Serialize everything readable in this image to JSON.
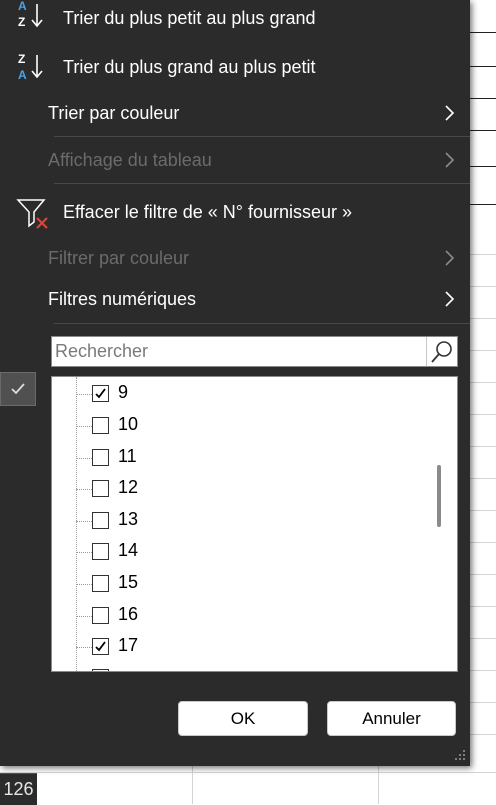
{
  "menu": {
    "sort_asc": "Trier du plus petit au plus grand",
    "sort_desc": "Trier du plus grand au plus petit",
    "sort_by_color": "Trier par couleur",
    "table_view": "Affichage du tableau",
    "clear_filter": "Effacer le filtre de « N° fournisseur »",
    "filter_by_color": "Filtrer par couleur",
    "number_filters": "Filtres numériques"
  },
  "sort_icon_letters": {
    "a": "A",
    "z": "Z"
  },
  "search": {
    "placeholder": "Rechercher",
    "value": ""
  },
  "list": {
    "items": [
      {
        "label": "9",
        "checked": true
      },
      {
        "label": "10",
        "checked": false
      },
      {
        "label": "11",
        "checked": false
      },
      {
        "label": "12",
        "checked": false
      },
      {
        "label": "13",
        "checked": false
      },
      {
        "label": "14",
        "checked": false
      },
      {
        "label": "15",
        "checked": false
      },
      {
        "label": "16",
        "checked": false
      },
      {
        "label": "17",
        "checked": true
      }
    ]
  },
  "buttons": {
    "ok": "OK",
    "cancel": "Annuler"
  },
  "sheet": {
    "row_number": "126"
  },
  "colors": {
    "panel_bg": "#2b2b2b",
    "accent_blue": "#4aa3e8",
    "clear_red": "#e0443a"
  }
}
